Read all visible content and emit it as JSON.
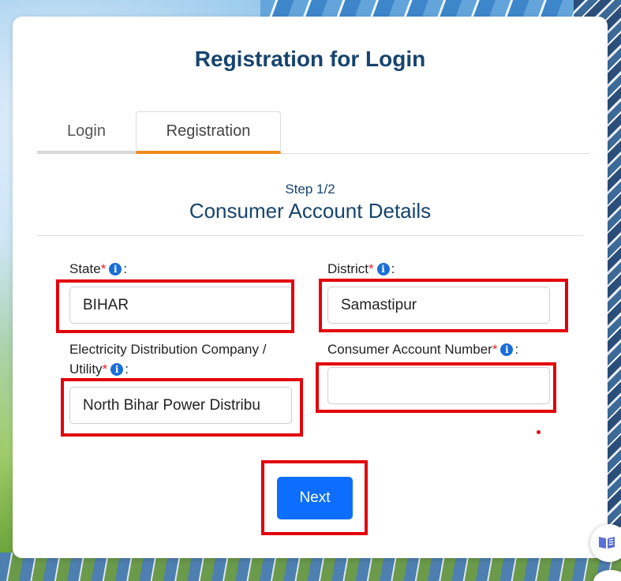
{
  "page": {
    "title": "Registration for Login"
  },
  "tabs": [
    {
      "label": "Login",
      "active": false
    },
    {
      "label": "Registration",
      "active": true
    }
  ],
  "step": {
    "indicator": "Step 1/2",
    "title": "Consumer Account Details"
  },
  "form": {
    "state": {
      "label": "State",
      "required_mark": "*",
      "suffix": ":",
      "value": "BIHAR"
    },
    "district": {
      "label": "District",
      "required_mark": "*",
      "suffix": ":",
      "value": "Samastipur"
    },
    "utility": {
      "label_line1": "Electricity Distribution Company /",
      "label_line2": "Utility",
      "required_mark": "*",
      "suffix": ":",
      "value": "North Bihar Power Distribu"
    },
    "account_number": {
      "label": "Consumer Account Number",
      "required_mark": "*",
      "suffix": ":",
      "value": ""
    }
  },
  "actions": {
    "next_label": "Next"
  },
  "icons": {
    "info": "info-circle-icon",
    "info_glyph": "i",
    "help": "book-reader-icon"
  },
  "colors": {
    "title": "#16446e",
    "accent_tab": "#f08a1c",
    "primary_button": "#0d6efd",
    "highlight": "#e3000b",
    "required": "#e0242a"
  }
}
